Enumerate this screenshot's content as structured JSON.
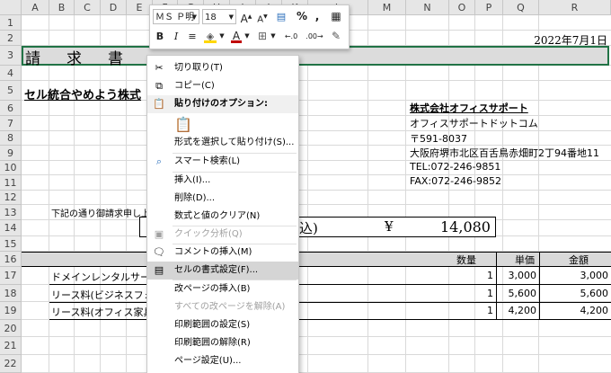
{
  "columns": [
    "A",
    "B",
    "C",
    "D",
    "E",
    "F",
    "G",
    "H",
    "I",
    "J",
    "K",
    "L",
    "M",
    "N",
    "O",
    "P",
    "Q",
    "R"
  ],
  "rows": [
    "1",
    "2",
    "3",
    "4",
    "5",
    "6",
    "7",
    "8",
    "9",
    "10",
    "11",
    "12",
    "13",
    "14",
    "15",
    "16",
    "17",
    "18",
    "19",
    "20",
    "21",
    "22"
  ],
  "sheet": {
    "date": "2022年7月1日",
    "title": "請　求　書",
    "client": "セル統合やめよう株式",
    "company_name": "株式会社オフィスサポート",
    "company_site": "オフィスサポートドットコム",
    "postal": "〒591-8037",
    "address": "大阪府堺市北区百舌鳥赤畑町2丁94番地11",
    "tel": "TEL:072-246-9851",
    "fax": "FAX:072-246-9852",
    "request_text": "下記の通り御請求申し上",
    "total_tax": "込)",
    "yen": "¥",
    "total": "14,080",
    "header_qty": "数量",
    "header_price": "単価",
    "header_amount": "金額",
    "items": [
      {
        "name": "ドメインレンタルサーバ",
        "qty": "1",
        "price": "3,000",
        "amount": "3,000"
      },
      {
        "name": "リース料(ビジネスフォ",
        "qty": "1",
        "price": "5,600",
        "amount": "5,600"
      },
      {
        "name": "リース料(オフィス家具",
        "qty": "1",
        "price": "4,200",
        "amount": "4,200"
      }
    ]
  },
  "mini_toolbar": {
    "font_name": "ＭＳ Ｐ明",
    "font_size": "18",
    "grow": "A",
    "shrink": "A",
    "percent": "%",
    "comma": ",",
    "bold": "B",
    "italic": "I",
    "font_color_letter": "A",
    "dec_inc": "←.0",
    "dec_dec": ".00→"
  },
  "context_menu": {
    "cut": "切り取り(T)",
    "copy": "コピー(C)",
    "paste_options": "貼り付けのオプション:",
    "paste_special": "形式を選択して貼り付け(S)...",
    "smart_lookup": "スマート検索(L)",
    "insert": "挿入(I)...",
    "delete": "削除(D)...",
    "clear": "数式と値のクリア(N)",
    "quick_analysis": "クイック分析(Q)",
    "insert_comment": "コメントの挿入(M)",
    "format_cells": "セルの書式設定(F)...",
    "insert_page_break": "改ページの挿入(B)",
    "reset_page_breaks": "すべての改ページを解除(A)",
    "set_print_area": "印刷範囲の設定(S)",
    "clear_print_area": "印刷範囲の解除(R)",
    "page_setup": "ページ設定(U)..."
  },
  "colors": {
    "accent_green": "#217346",
    "font_red": "#c00000",
    "highlight_yellow": "#ffd700"
  }
}
